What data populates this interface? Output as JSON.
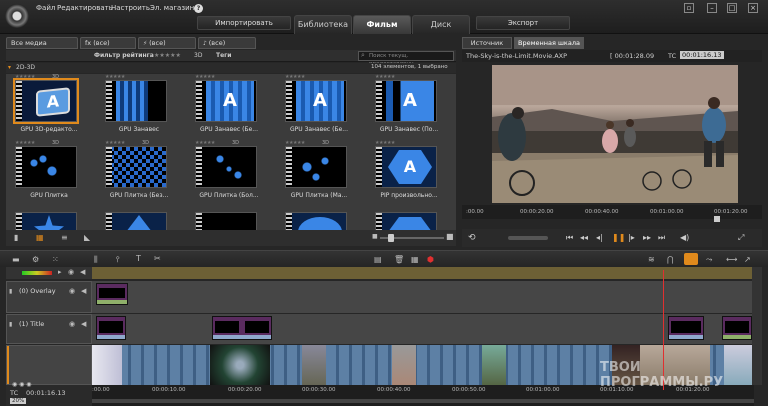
{
  "menu": {
    "items": [
      "Файл",
      "Редактировать",
      "Настроить",
      "Эл. магазин"
    ]
  },
  "top": {
    "import_label": "Импортировать",
    "export_label": "Экспорт"
  },
  "tabs": [
    "Библиотека",
    "Фильм",
    "Диск"
  ],
  "active_tab": "Фильм",
  "library": {
    "tabs": [
      "Все медиа",
      "fx (все)",
      "(все)",
      "(все)"
    ],
    "filter_label": "Фильтр рейтинга",
    "filter_stars": "★★★★★",
    "filter_3d": "3D",
    "tags_label": "Теги",
    "search_placeholder": "Поиск текущ. предоставленн",
    "count_text": "104 элементов, 1 выбрано",
    "group_label": "2D-3D",
    "items": [
      {
        "label": "GPU 3D-редакто...",
        "stars": "★★★★★",
        "tag": "3D"
      },
      {
        "label": "GPU Занавес",
        "stars": "★★★★★",
        "tag": ""
      },
      {
        "label": "GPU Занавес (Бе...",
        "stars": "★★★★★",
        "tag": ""
      },
      {
        "label": "GPU Занавес (Бе...",
        "stars": "★★★★★",
        "tag": ""
      },
      {
        "label": "GPU Занавес (По...",
        "stars": "★★★★★",
        "tag": ""
      },
      {
        "label": "GPU Плитка",
        "stars": "★★★★★",
        "tag": "3D"
      },
      {
        "label": "GPU Плитка (Без...",
        "stars": "★★★★★",
        "tag": "3D"
      },
      {
        "label": "GPU Плитка (Бол...",
        "stars": "★★★★★",
        "tag": "3D"
      },
      {
        "label": "GPU Плитка (Ма...",
        "stars": "★★★★★",
        "tag": "3D"
      },
      {
        "label": "PIP произвольно...",
        "stars": "★★★★★",
        "tag": ""
      }
    ]
  },
  "player": {
    "tabs": [
      "Источник",
      "Временная шкала"
    ],
    "filename": "The-Sky-is-the-Limit.Movie.AXP",
    "duration": "[ 00:01:28.09",
    "tc_label": "TC",
    "tc_value": "00:01:16.13",
    "ruler": [
      ":00.00",
      "00:00:20.00",
      "00:00:40.00",
      "00:01:00.00",
      "00:01:20.00"
    ]
  },
  "timeline": {
    "tracks": [
      "(0) Overlay",
      "(1) Title"
    ],
    "tc_label": "TC",
    "tc_value": "00:01:16.13",
    "zoom": "20%",
    "ruler": [
      ":00.00",
      "00:00:10.00",
      "00:00:20.00",
      "00:00:30.00",
      "00:00:40.00",
      "00:00:50.00",
      "00:01:00.00",
      "00:01:10.00",
      "00:01:20.00"
    ]
  },
  "watermark": "ТВОИ ПРОГРАММЫ.РУ"
}
